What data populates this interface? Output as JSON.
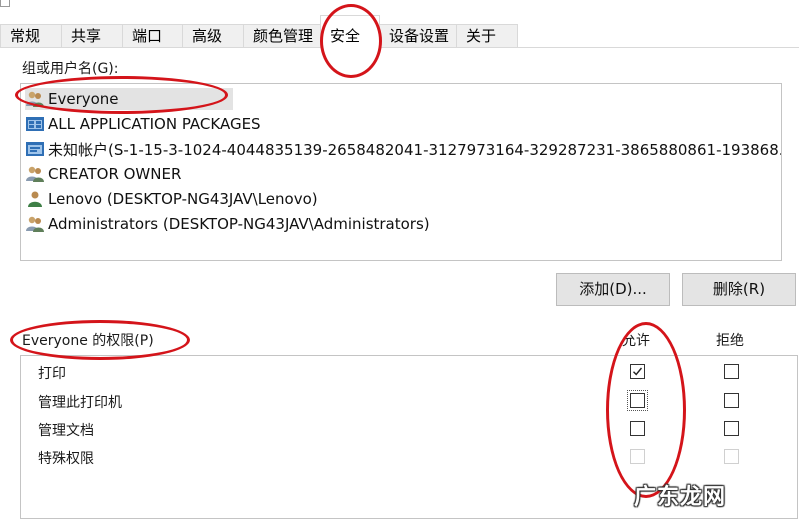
{
  "tabs": [
    {
      "label": "常规"
    },
    {
      "label": "共享"
    },
    {
      "label": "端口"
    },
    {
      "label": "高级"
    },
    {
      "label": "颜色管理"
    },
    {
      "label": "安全"
    },
    {
      "label": "设备设置"
    },
    {
      "label": "关于"
    }
  ],
  "active_tab": "安全",
  "users_label": "组或用户名(G):",
  "users": [
    {
      "name": "Everyone",
      "icon": "group-users-icon",
      "selected": true
    },
    {
      "name": "ALL APPLICATION PACKAGES",
      "icon": "app-packages-icon"
    },
    {
      "name": "未知帐户(S-1-15-3-1024-4044835139-2658482041-3127973164-329287231-3865880861-193868...",
      "icon": "unknown-account-icon"
    },
    {
      "name": "CREATOR OWNER",
      "icon": "group-users-icon"
    },
    {
      "name": "Lenovo (DESKTOP-NG43JAV\\Lenovo)",
      "icon": "single-user-icon"
    },
    {
      "name": "Administrators (DESKTOP-NG43JAV\\Administrators)",
      "icon": "group-users-icon"
    }
  ],
  "buttons": {
    "add": "添加(D)...",
    "remove": "删除(R)"
  },
  "permissions": {
    "title": "Everyone 的权限(P)",
    "allow_header": "允许",
    "deny_header": "拒绝",
    "rows": [
      {
        "name": "打印",
        "allow": true,
        "deny": false,
        "enabled": true
      },
      {
        "name": "管理此打印机",
        "allow": false,
        "deny": false,
        "enabled": true,
        "focused": true
      },
      {
        "name": "管理文档",
        "allow": false,
        "deny": false,
        "enabled": true
      },
      {
        "name": "特殊权限",
        "allow": false,
        "deny": false,
        "enabled": false
      }
    ]
  },
  "watermark": "广东龙网",
  "colors": {
    "annotation": "#d4141a",
    "selection": "#e3e3e3",
    "tab_bg": "#f0f0f0"
  }
}
